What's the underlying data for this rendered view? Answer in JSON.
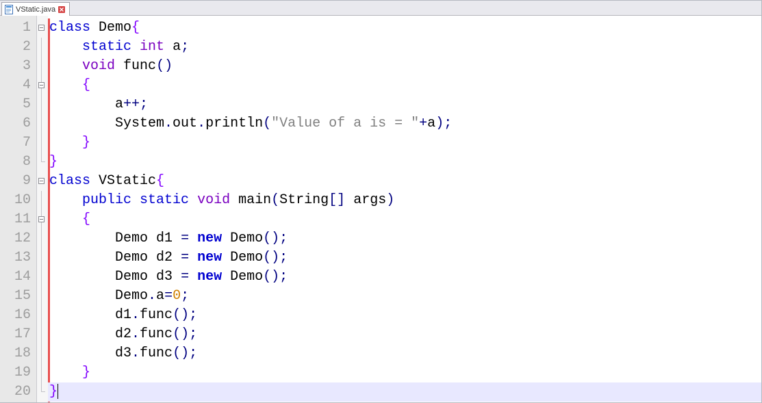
{
  "tab": {
    "filename": "VStatic.java"
  },
  "gutter": [
    "1",
    "2",
    "3",
    "4",
    "5",
    "6",
    "7",
    "8",
    "9",
    "10",
    "11",
    "12",
    "13",
    "14",
    "15",
    "16",
    "17",
    "18",
    "19",
    "20"
  ],
  "code": {
    "line1": {
      "kw_class": "class",
      "sp": " ",
      "ident": "Demo",
      "brace": "{"
    },
    "line2": {
      "indent": "    ",
      "kw_static": "static",
      "sp": " ",
      "type": "int",
      "sp2": " ",
      "ident": "a",
      "semi": ";"
    },
    "line3": {
      "indent": "    ",
      "type": "void",
      "sp": " ",
      "ident": "func",
      "paren": "()"
    },
    "line4": {
      "indent": "    ",
      "brace": "{"
    },
    "line5": {
      "indent": "        ",
      "ident": "a",
      "op": "++",
      "semi": ";"
    },
    "line6": {
      "indent": "        ",
      "sys": "System",
      "dot1": ".",
      "out": "out",
      "dot2": ".",
      "pln": "println",
      "lparen": "(",
      "str": "\"Value of a is = \"",
      "plus": "+",
      "a2": "a",
      "rparen": ")",
      "semi": ";"
    },
    "line7": {
      "indent": "    ",
      "brace": "}"
    },
    "line8": {
      "brace": "}"
    },
    "line9": {
      "kw_class": "class",
      "sp": " ",
      "ident": "VStatic",
      "brace": "{"
    },
    "line10": {
      "indent": "    ",
      "kw_public": "public",
      "sp": " ",
      "kw_static": "static",
      "sp2": " ",
      "type": "void",
      "sp3": " ",
      "ident": "main",
      "lparen": "(",
      "str_t": "String",
      "brk": "[]",
      "sp4": " ",
      "args": "args",
      "rparen": ")"
    },
    "line11": {
      "indent": "    ",
      "brace": "{"
    },
    "line12": {
      "indent": "        ",
      "type": "Demo",
      "sp": " ",
      "ident": "d1",
      "sp2": " ",
      "eq": "=",
      "sp3": " ",
      "kw_new": "new",
      "sp4": " ",
      "ctor": "Demo",
      "paren": "()",
      "semi": ";"
    },
    "line13": {
      "indent": "        ",
      "type": "Demo",
      "sp": " ",
      "ident": "d2",
      "sp2": " ",
      "eq": "=",
      "sp3": " ",
      "kw_new": "new",
      "sp4": " ",
      "ctor": "Demo",
      "paren": "()",
      "semi": ";"
    },
    "line14": {
      "indent": "        ",
      "type": "Demo",
      "sp": " ",
      "ident": "d3",
      "sp2": " ",
      "eq": "=",
      "sp3": " ",
      "kw_new": "new",
      "sp4": " ",
      "ctor": "Demo",
      "paren": "()",
      "semi": ";"
    },
    "line15": {
      "indent": "        ",
      "cls": "Demo",
      "dot": ".",
      "fld": "a",
      "eq": "=",
      "num": "0",
      "semi": ";"
    },
    "line16": {
      "indent": "        ",
      "obj": "d1",
      "dot": ".",
      "fn": "func",
      "paren": "()",
      "semi": ";"
    },
    "line17": {
      "indent": "        ",
      "obj": "d2",
      "dot": ".",
      "fn": "func",
      "paren": "()",
      "semi": ";"
    },
    "line18": {
      "indent": "        ",
      "obj": "d3",
      "dot": ".",
      "fn": "func",
      "paren": "()",
      "semi": ";"
    },
    "line19": {
      "indent": "    ",
      "brace": "}"
    },
    "line20": {
      "brace": "}"
    }
  }
}
